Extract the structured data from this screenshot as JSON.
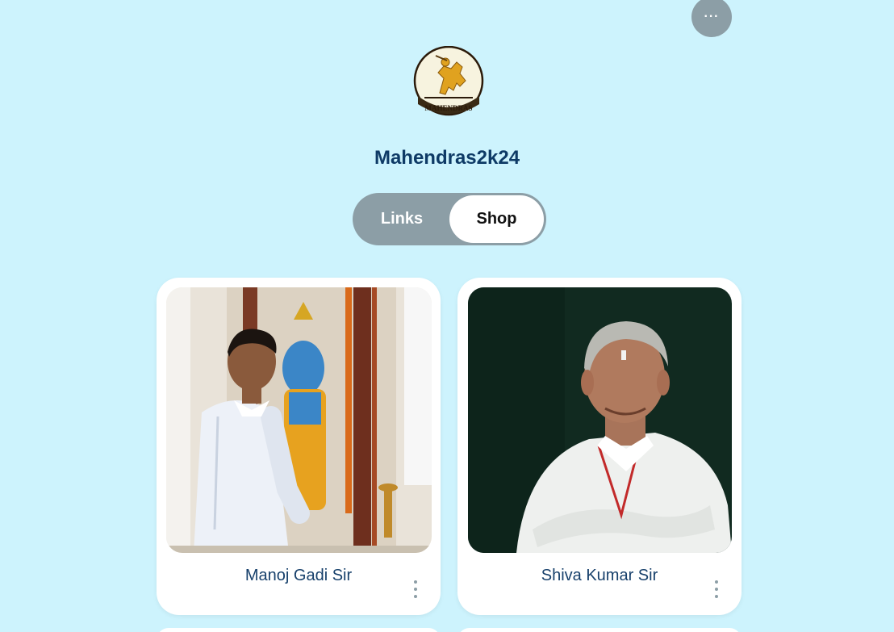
{
  "header": {
    "more_label": "···",
    "profile_name": "Mahendras2k24",
    "logo_text": "MAHENDRAS"
  },
  "toggle": {
    "links_label": "Links",
    "shop_label": "Shop",
    "active": "Shop"
  },
  "products": [
    {
      "title": "Manoj Gadi Sir"
    },
    {
      "title": "Shiva Kumar Sir"
    }
  ],
  "colors": {
    "background": "#cdf3fd",
    "title": "#0e3a66",
    "toggle_bg": "#8c9ea6",
    "card_bg": "#ffffff"
  },
  "icons": {
    "more": "ellipsis-icon",
    "card_menu": "vertical-ellipsis-icon"
  }
}
